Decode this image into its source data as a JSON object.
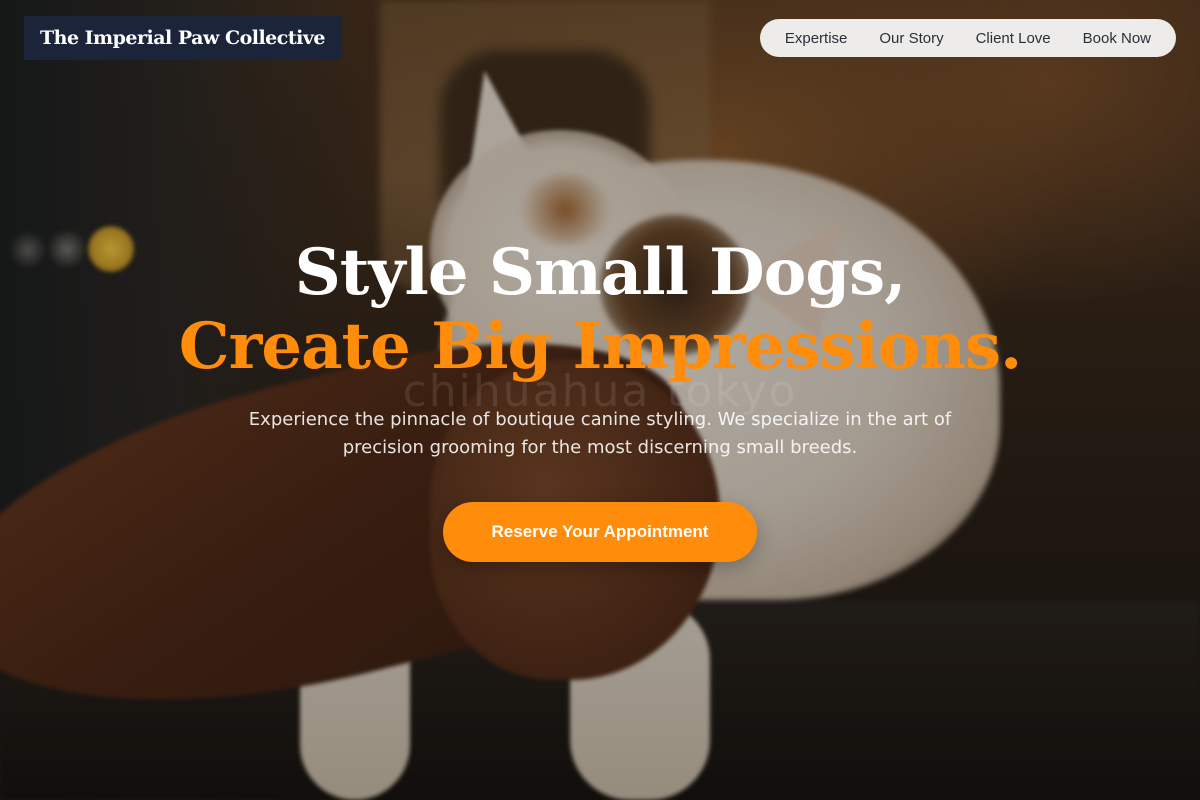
{
  "header": {
    "brand": "The Imperial Paw Collective",
    "nav": [
      {
        "label": "Expertise"
      },
      {
        "label": "Our Story"
      },
      {
        "label": "Client Love"
      },
      {
        "label": "Book Now"
      }
    ]
  },
  "hero": {
    "headline_line1": "Style Small Dogs,",
    "headline_line2": "Create Big Impressions.",
    "watermark": "chihuahua tokyo",
    "subtitle": "Experience the pinnacle of boutique canine styling. We specialize in the art of precision grooming for the most discerning small breeds.",
    "cta_label": "Reserve Your Appointment"
  },
  "colors": {
    "accent": "#ff8c0a",
    "brand_bg": "#1b2438",
    "nav_bg": "#f5f4f2"
  }
}
